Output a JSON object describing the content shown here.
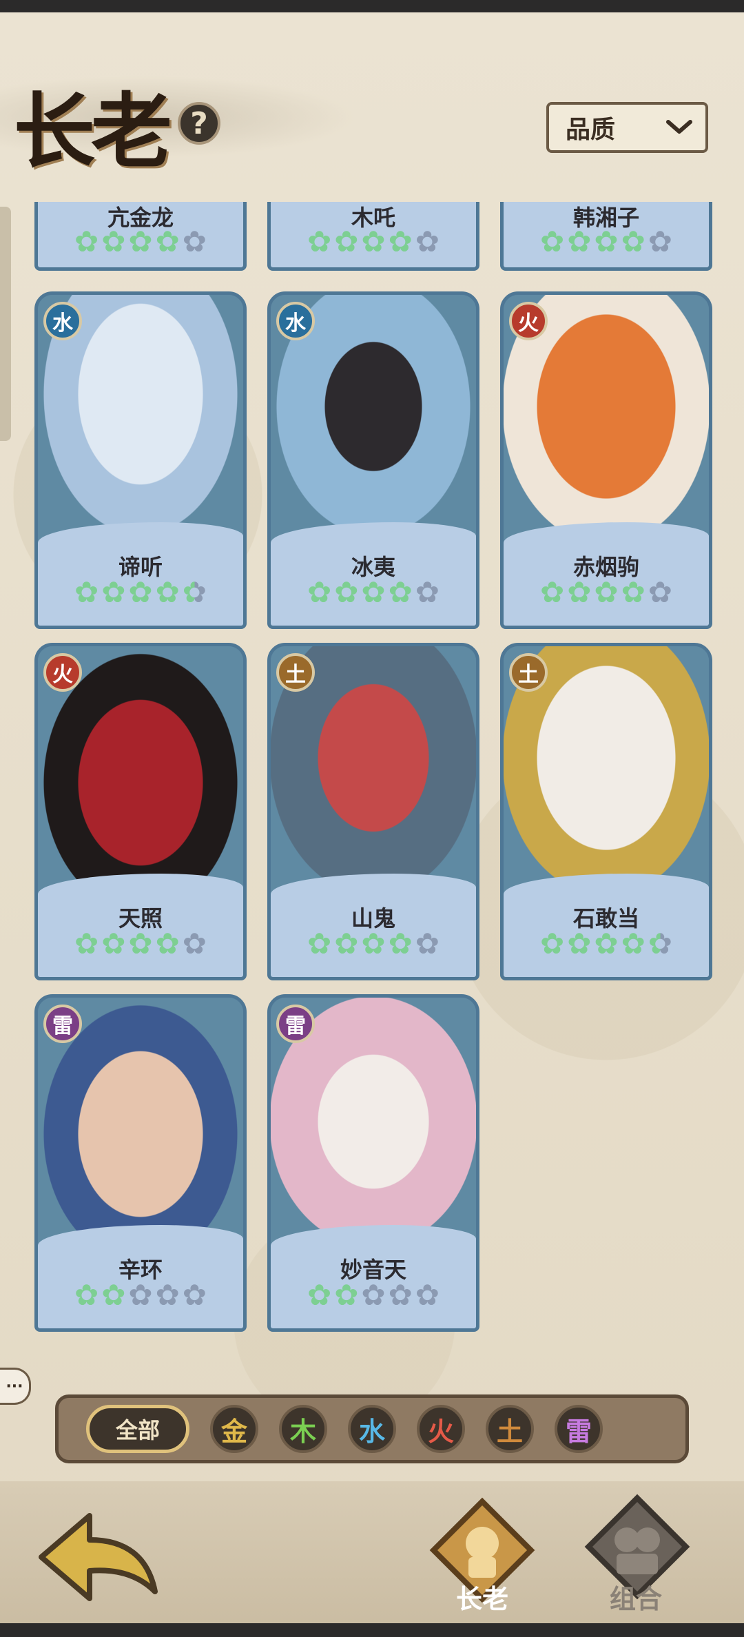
{
  "header": {
    "title": "长老",
    "help": "?",
    "sort_label": "品质"
  },
  "top_row": [
    {
      "name": "亢金龙",
      "stars": 4
    },
    {
      "name": "木吒",
      "stars": 4
    },
    {
      "name": "韩湘子",
      "stars": 4
    }
  ],
  "cards": [
    {
      "name": "谛听",
      "element": "水",
      "stars": 4.5,
      "color": "#2a6f9c"
    },
    {
      "name": "冰夷",
      "element": "水",
      "stars": 4,
      "color": "#2a6f9c"
    },
    {
      "name": "赤烟驹",
      "element": "火",
      "stars": 4,
      "color": "#b73b2c"
    },
    {
      "name": "天照",
      "element": "火",
      "stars": 4,
      "color": "#b73b2c"
    },
    {
      "name": "山鬼",
      "element": "土",
      "stars": 4,
      "color": "#9a6a2b"
    },
    {
      "name": "石敢当",
      "element": "土",
      "stars": 4.5,
      "color": "#9a6a2b"
    },
    {
      "name": "辛环",
      "element": "雷",
      "stars": 2,
      "color": "#7b3f86"
    },
    {
      "name": "妙音天",
      "element": "雷",
      "stars": 2,
      "color": "#7b3f86"
    }
  ],
  "filters": {
    "all": "全部",
    "elements": [
      {
        "label": "金",
        "color": "#e0b84a"
      },
      {
        "label": "木",
        "color": "#7bcf52"
      },
      {
        "label": "水",
        "color": "#58b8e6"
      },
      {
        "label": "火",
        "color": "#e55a48"
      },
      {
        "label": "土",
        "color": "#d08a3c"
      },
      {
        "label": "雷",
        "color": "#c77be0"
      }
    ]
  },
  "nav": {
    "elder": "长老",
    "team": "组合"
  },
  "icons": {
    "back": "back-arrow-icon",
    "chat": "chat-bubble-icon",
    "sort": "chevron-down-icon"
  }
}
